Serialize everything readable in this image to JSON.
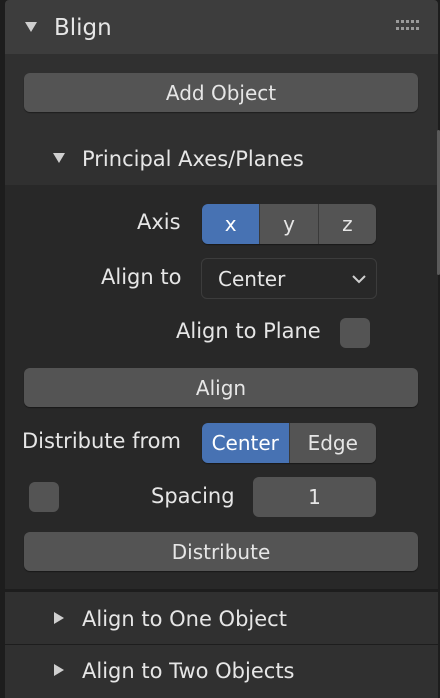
{
  "panel": {
    "title": "Blign",
    "add_object_label": "Add Object"
  },
  "principal": {
    "title": "Principal Axes/Planes",
    "axis_label": "Axis",
    "axis_options": [
      "x",
      "y",
      "z"
    ],
    "axis_selected": "x",
    "align_to_label": "Align to",
    "align_to_value": "Center",
    "align_to_plane_label": "Align to Plane",
    "align_to_plane_checked": false,
    "align_button_label": "Align",
    "distribute_from_label": "Distribute from",
    "distribute_options": [
      "Center",
      "Edge"
    ],
    "distribute_selected": "Center",
    "spacing_enabled": false,
    "spacing_label": "Spacing",
    "spacing_value": "1",
    "distribute_button_label": "Distribute"
  },
  "collapsed_sections": [
    {
      "title": "Align to One Object"
    },
    {
      "title": "Align to Two Objects"
    }
  ],
  "colors": {
    "accent": "#4772b3",
    "button": "#545454",
    "panel_header": "#3d3d3d",
    "panel_body": "#303030",
    "subpanel_body": "#282828"
  }
}
